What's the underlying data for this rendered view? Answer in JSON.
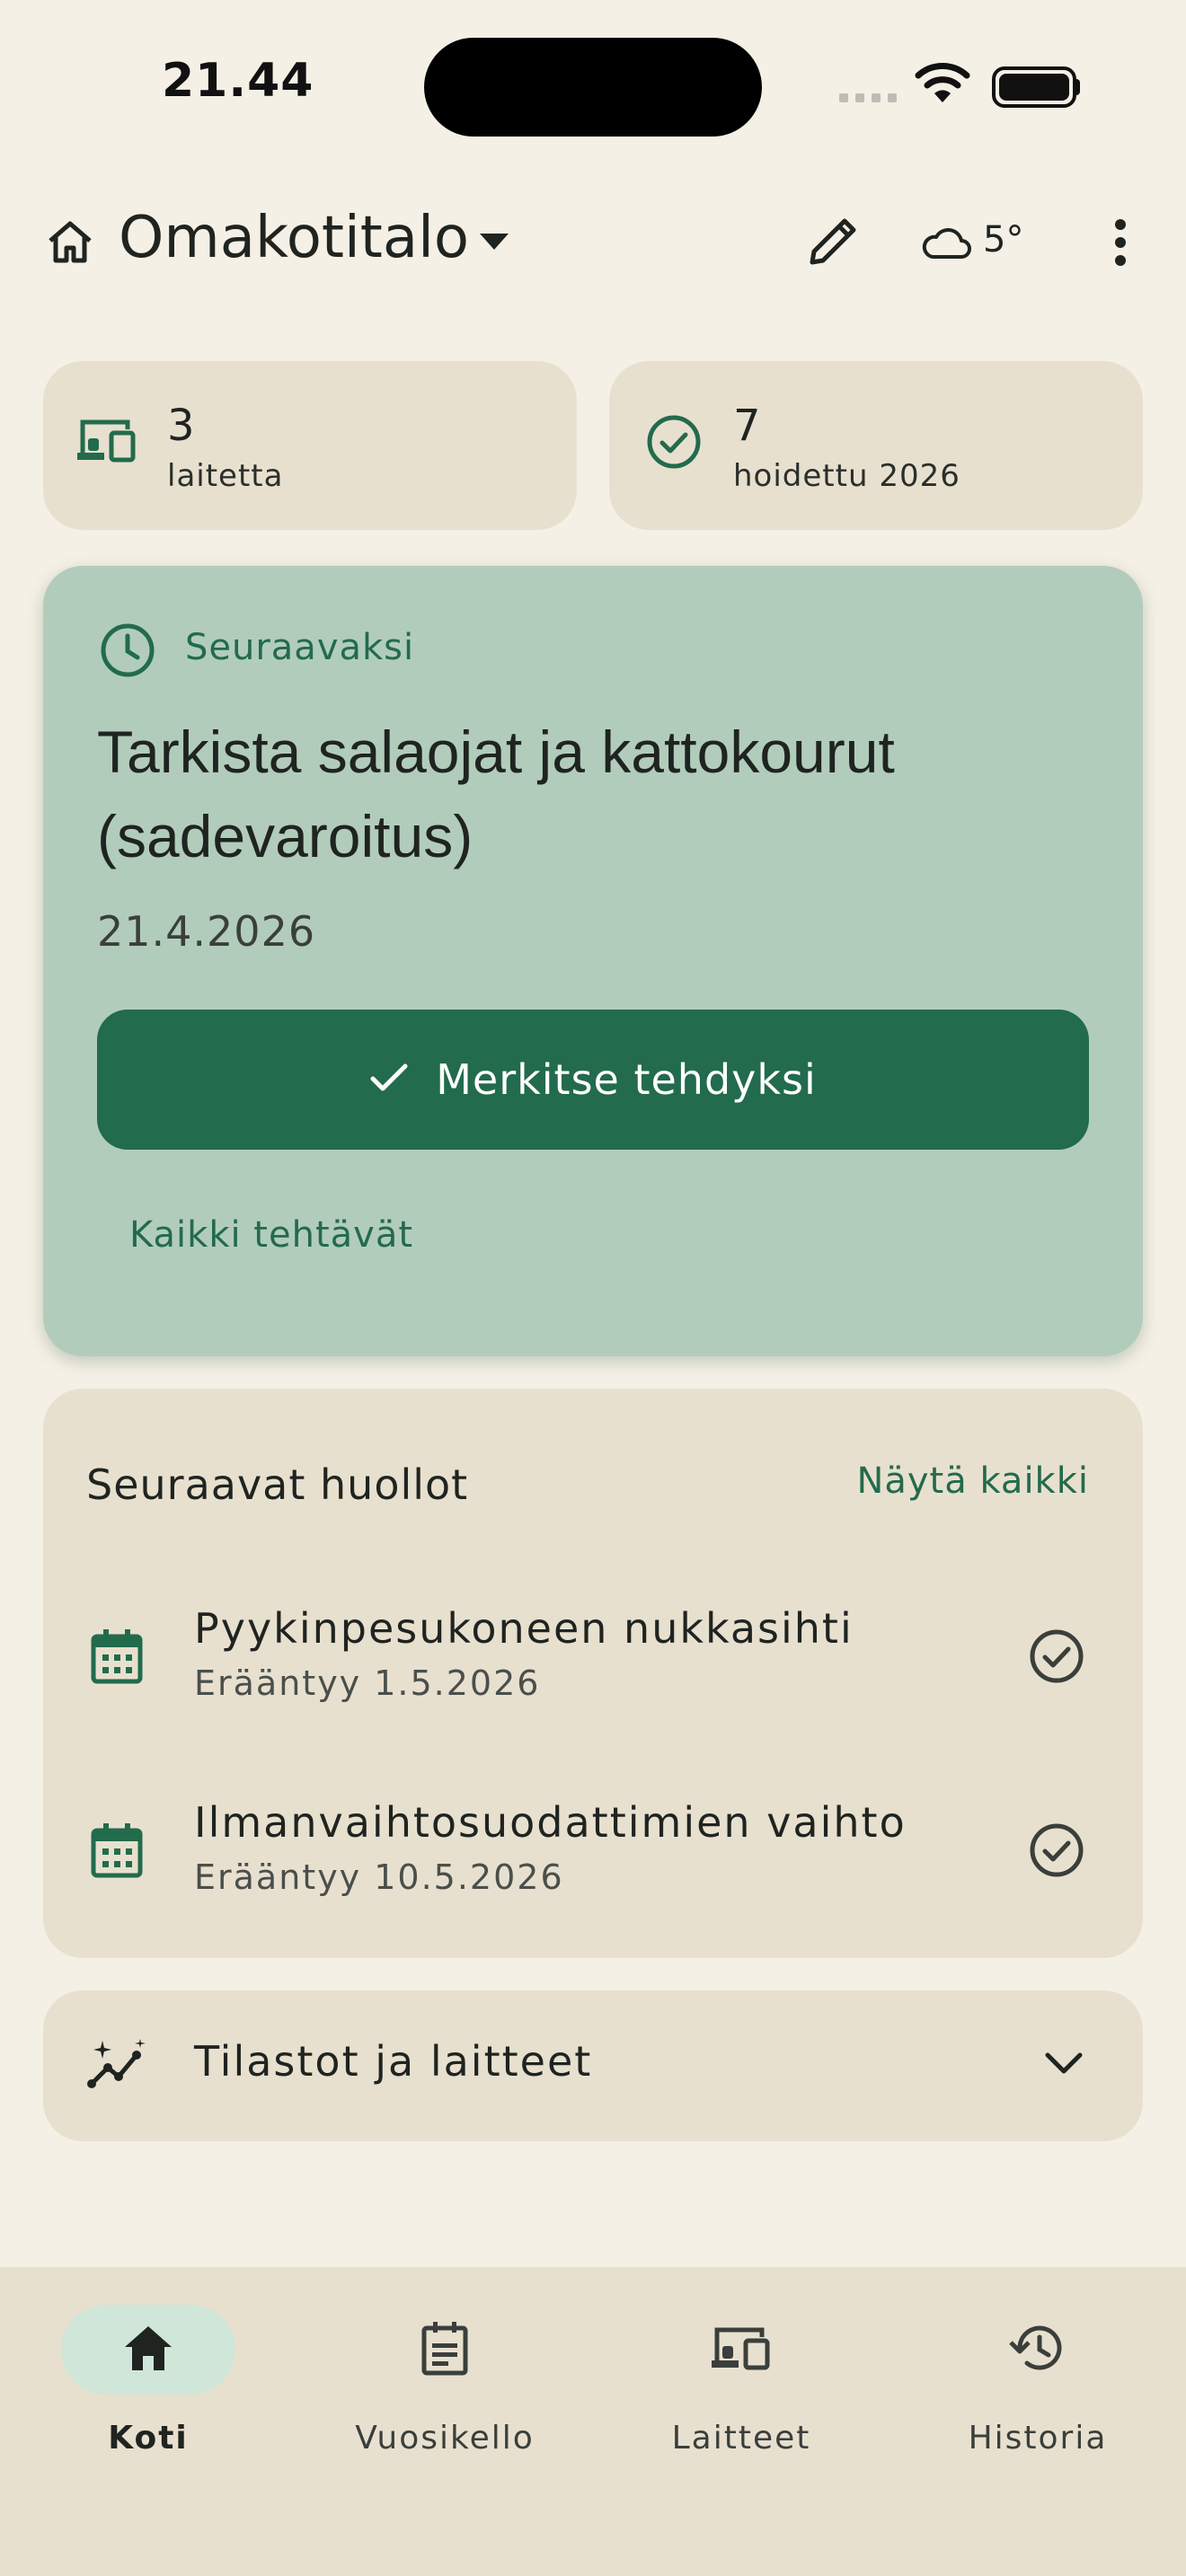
{
  "status_bar": {
    "time": "21.44"
  },
  "header": {
    "title": "Omakotitalo",
    "weather_temp": "5°",
    "icons": [
      "home-icon",
      "dropdown-caret-icon",
      "edit-icon",
      "cloud-icon",
      "more-vert-icon"
    ]
  },
  "stats": [
    {
      "value": "3",
      "label": "laitetta",
      "icon": "devices-icon"
    },
    {
      "value": "7",
      "label": "hoidettu 2026",
      "icon": "check-circle-icon"
    }
  ],
  "next_task": {
    "label": "Seuraavaksi",
    "title": "Tarkista salaojat ja kattokourut (sadevaroitus)",
    "date": "21.4.2026",
    "button_label": "Merkitse tehdyksi",
    "link_label": "Kaikki tehtävät"
  },
  "upcoming": {
    "title": "Seuraavat huollot",
    "show_all_label": "Näytä kaikki",
    "items": [
      {
        "title": "Pyykinpesukoneen nukkasihti",
        "subtitle": "Erääntyy 1.5.2026"
      },
      {
        "title": "Ilmanvaihtosuodattimien vaihto",
        "subtitle": "Erääntyy 10.5.2026"
      }
    ]
  },
  "stats_section": {
    "label": "Tilastot ja laitteet"
  },
  "bottom_nav": {
    "items": [
      {
        "label": "Koti",
        "icon": "home-icon",
        "active": true
      },
      {
        "label": "Vuosikello",
        "icon": "calendar-notes-icon",
        "active": false
      },
      {
        "label": "Laitteet",
        "icon": "devices-icon",
        "active": false
      },
      {
        "label": "Historia",
        "icon": "history-icon",
        "active": false
      }
    ]
  },
  "colors": {
    "background": "#f5f0e6",
    "card": "#e8e0cf",
    "accent": "#226b4c",
    "next_card": "#b2ccbc",
    "nav_active": "#cfe6d8"
  }
}
